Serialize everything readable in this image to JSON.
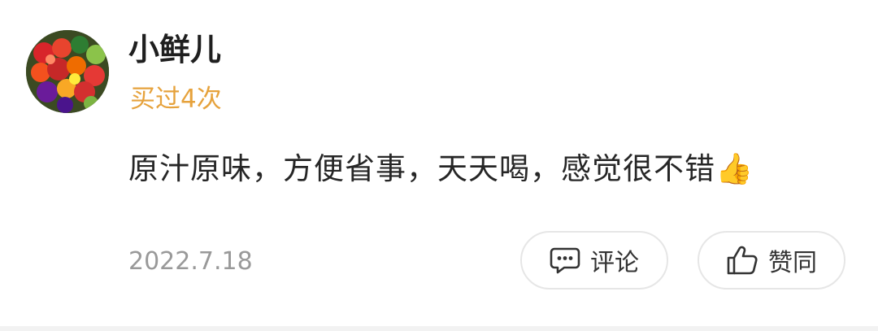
{
  "user": {
    "name": "小鲜儿",
    "avatar_icon": "vegetables-avatar"
  },
  "purchase": {
    "label": "买过4次",
    "color": "#e6a23c"
  },
  "review": {
    "text": "原汁原味，方便省事，天天喝，感觉很不错👍"
  },
  "meta": {
    "date": "2022.7.18"
  },
  "actions": {
    "comment_label": "评论",
    "comment_icon": "comment-bubble-icon",
    "like_label": "赞同",
    "like_icon": "thumbs-up-icon"
  }
}
